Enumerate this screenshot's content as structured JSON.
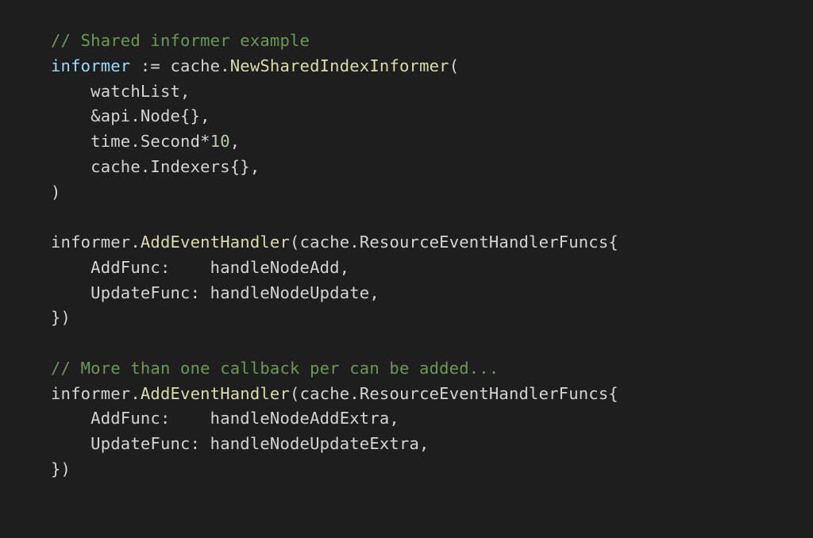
{
  "code": {
    "lines": [
      [
        {
          "cls": "tok-comment",
          "text": "// Shared informer example"
        }
      ],
      [
        {
          "cls": "tok-ident",
          "text": "informer"
        },
        {
          "cls": "tok-plain",
          "text": " := cache."
        },
        {
          "cls": "tok-func",
          "text": "NewSharedIndexInformer"
        },
        {
          "cls": "tok-plain",
          "text": "("
        }
      ],
      [
        {
          "cls": "indent-guide",
          "text": "    "
        },
        {
          "cls": "tok-plain",
          "text": "watchList,"
        }
      ],
      [
        {
          "cls": "indent-guide",
          "text": "    "
        },
        {
          "cls": "tok-plain",
          "text": "&api.Node{},"
        }
      ],
      [
        {
          "cls": "indent-guide",
          "text": "    "
        },
        {
          "cls": "tok-plain",
          "text": "time.Second*"
        },
        {
          "cls": "tok-num",
          "text": "10"
        },
        {
          "cls": "tok-plain",
          "text": ","
        }
      ],
      [
        {
          "cls": "indent-guide",
          "text": "    "
        },
        {
          "cls": "tok-plain",
          "text": "cache.Indexers{},"
        }
      ],
      [
        {
          "cls": "tok-plain",
          "text": ")"
        }
      ],
      [
        {
          "cls": "tok-plain",
          "text": ""
        }
      ],
      [
        {
          "cls": "tok-plain",
          "text": "informer."
        },
        {
          "cls": "tok-func",
          "text": "AddEventHandler"
        },
        {
          "cls": "tok-plain",
          "text": "(cache.ResourceEventHandlerFuncs{"
        }
      ],
      [
        {
          "cls": "indent-guide",
          "text": "    "
        },
        {
          "cls": "tok-plain",
          "text": "AddFunc:    handleNodeAdd,"
        }
      ],
      [
        {
          "cls": "indent-guide",
          "text": "    "
        },
        {
          "cls": "tok-plain",
          "text": "UpdateFunc: handleNodeUpdate,"
        }
      ],
      [
        {
          "cls": "tok-plain",
          "text": "})"
        }
      ],
      [
        {
          "cls": "tok-plain",
          "text": ""
        }
      ],
      [
        {
          "cls": "tok-comment",
          "text": "// More than one callback per can be added..."
        }
      ],
      [
        {
          "cls": "tok-plain",
          "text": "informer."
        },
        {
          "cls": "tok-func",
          "text": "AddEventHandler"
        },
        {
          "cls": "tok-plain",
          "text": "(cache.ResourceEventHandlerFuncs{"
        }
      ],
      [
        {
          "cls": "indent-guide",
          "text": "    "
        },
        {
          "cls": "tok-plain",
          "text": "AddFunc:    handleNodeAddExtra,"
        }
      ],
      [
        {
          "cls": "indent-guide",
          "text": "    "
        },
        {
          "cls": "tok-plain",
          "text": "UpdateFunc: handleNodeUpdateExtra,"
        }
      ],
      [
        {
          "cls": "tok-plain",
          "text": "})"
        }
      ]
    ]
  }
}
